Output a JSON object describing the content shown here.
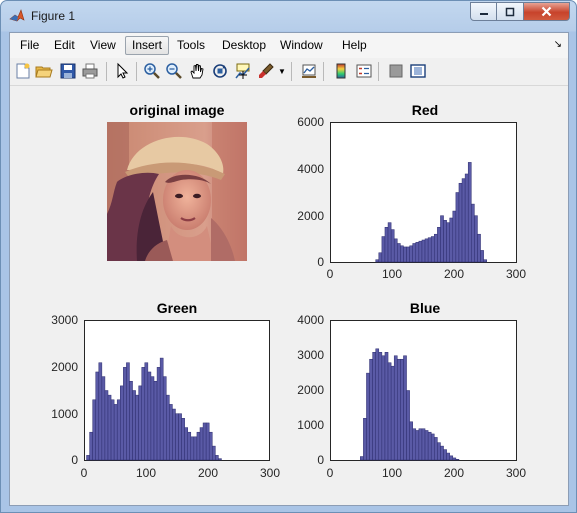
{
  "window": {
    "title": "Figure 1"
  },
  "menu": {
    "items": [
      "File",
      "Edit",
      "View",
      "Insert",
      "Tools",
      "Desktop",
      "Window",
      "Help"
    ],
    "active": "Insert",
    "dock_glyph": "↘"
  },
  "toolbar": {
    "buttons": [
      "new-figure",
      "open-file",
      "save",
      "print",
      "select-arrow",
      "zoom-in",
      "zoom-out",
      "pan",
      "rotate-3d",
      "data-cursor",
      "brush",
      "link-plot",
      "colorbar",
      "legend",
      "hide-plot-tools",
      "show-plot-tools"
    ]
  },
  "colors": {
    "bar_fill": "#5a5aa6",
    "bar_edge": "#2d2d6e"
  },
  "image_panel": {
    "title": "original image"
  },
  "chart_data": [
    {
      "type": "bar",
      "title": "Red",
      "xlim": [
        0,
        300
      ],
      "ylim": [
        0,
        6000
      ],
      "xticks": [
        0,
        100,
        200,
        300
      ],
      "yticks": [
        0,
        2000,
        4000,
        6000
      ],
      "x": [
        75,
        80,
        85,
        90,
        95,
        100,
        105,
        110,
        115,
        120,
        125,
        130,
        135,
        140,
        145,
        150,
        155,
        160,
        165,
        170,
        175,
        180,
        185,
        190,
        195,
        200,
        205,
        210,
        215,
        220,
        225,
        230,
        235,
        240,
        245,
        250
      ],
      "values": [
        100,
        400,
        1100,
        1500,
        1700,
        1400,
        1000,
        800,
        700,
        650,
        650,
        700,
        800,
        850,
        900,
        950,
        1000,
        1050,
        1100,
        1200,
        1500,
        2000,
        1800,
        1700,
        1900,
        2200,
        3000,
        3400,
        3600,
        3800,
        4300,
        2500,
        2000,
        1200,
        500,
        100
      ]
    },
    {
      "type": "bar",
      "title": "Green",
      "xlim": [
        0,
        300
      ],
      "ylim": [
        0,
        3000
      ],
      "xticks": [
        0,
        100,
        200,
        300
      ],
      "yticks": [
        0,
        1000,
        2000,
        3000
      ],
      "x": [
        5,
        10,
        15,
        20,
        25,
        30,
        35,
        40,
        45,
        50,
        55,
        60,
        65,
        70,
        75,
        80,
        85,
        90,
        95,
        100,
        105,
        110,
        115,
        120,
        125,
        130,
        135,
        140,
        145,
        150,
        155,
        160,
        165,
        170,
        175,
        180,
        185,
        190,
        195,
        200,
        205,
        210,
        215,
        220
      ],
      "values": [
        100,
        600,
        1300,
        1900,
        2100,
        1800,
        1500,
        1400,
        1300,
        1200,
        1300,
        1600,
        2000,
        2100,
        1700,
        1500,
        1400,
        1600,
        2000,
        2100,
        1900,
        1800,
        1700,
        2000,
        2200,
        1800,
        1400,
        1200,
        1100,
        1000,
        1000,
        900,
        700,
        600,
        500,
        500,
        600,
        700,
        800,
        800,
        600,
        300,
        100,
        30
      ]
    },
    {
      "type": "bar",
      "title": "Blue",
      "xlim": [
        0,
        300
      ],
      "ylim": [
        0,
        4000
      ],
      "xticks": [
        0,
        100,
        200,
        300
      ],
      "yticks": [
        0,
        1000,
        2000,
        3000,
        4000
      ],
      "x": [
        50,
        55,
        60,
        65,
        70,
        75,
        80,
        85,
        90,
        95,
        100,
        105,
        110,
        115,
        120,
        125,
        130,
        135,
        140,
        145,
        150,
        155,
        160,
        165,
        170,
        175,
        180,
        185,
        190,
        195,
        200,
        205
      ],
      "values": [
        100,
        1200,
        2500,
        2900,
        3100,
        3200,
        3100,
        3000,
        3100,
        2800,
        2700,
        3000,
        2900,
        2900,
        3000,
        2000,
        1100,
        900,
        850,
        900,
        900,
        850,
        800,
        750,
        650,
        500,
        400,
        300,
        200,
        120,
        60,
        20
      ]
    }
  ]
}
